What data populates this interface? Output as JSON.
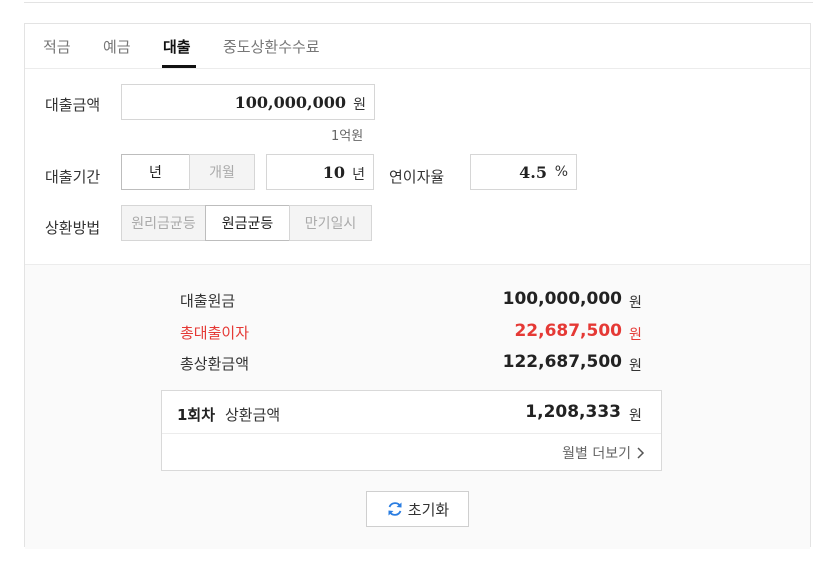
{
  "tabs": [
    {
      "label": "적금"
    },
    {
      "label": "예금"
    },
    {
      "label": "대출"
    },
    {
      "label": "중도상환수수료"
    }
  ],
  "form": {
    "amount_label": "대출금액",
    "amount_value": "100,000,000",
    "amount_unit": "원",
    "amount_hint": "1억원",
    "period_label": "대출기간",
    "period_year_option": "년",
    "period_month_option": "개월",
    "period_value": "10",
    "period_unit": "년",
    "rate_label": "연이자율",
    "rate_value": "4.5",
    "rate_unit": "%",
    "method_label": "상환방법",
    "methods": [
      "원리금균등",
      "원금균등",
      "만기일시"
    ]
  },
  "result": {
    "principal_label": "대출원금",
    "principal_value": "100,000,000",
    "interest_label": "총대출이자",
    "interest_value": "22,687,500",
    "total_label": "총상환금액",
    "total_value": "122,687,500",
    "unit": "원",
    "first_label_bold": "1회차",
    "first_label_rest": "상환금액",
    "first_value": "1,208,333",
    "monthly_more": "월별 더보기",
    "reset_label": "초기화"
  },
  "colors": {
    "accent_red": "#e53935",
    "reset_icon": "#2a7de1"
  }
}
